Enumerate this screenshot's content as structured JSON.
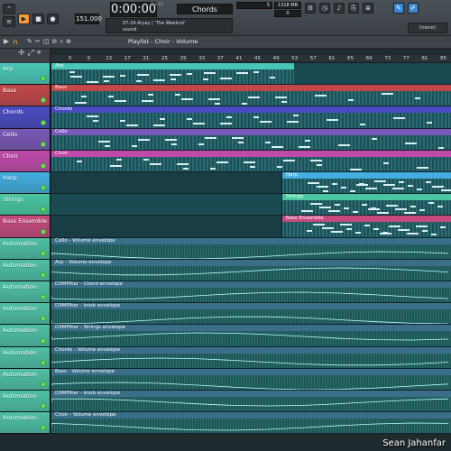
{
  "transport": {
    "time": "0:00:00",
    "time_unit": "M:S:CS",
    "tempo": "151.000",
    "pattern": "Chords",
    "voices": "5",
    "memory": "1318 MB",
    "mem_count": "0",
    "hint_line1": "07-24  Aryay | 'The Weeknd'",
    "hint_line2": "sound",
    "snap_label": "(none)"
  },
  "playlist": {
    "title": "Playlist - Choir - Volume",
    "ruler": [
      "5",
      "9",
      "13",
      "17",
      "21",
      "25",
      "29",
      "33",
      "37",
      "41",
      "45",
      "49",
      "53",
      "57",
      "61",
      "65",
      "69",
      "73",
      "77",
      "81",
      "85"
    ]
  },
  "tracks": [
    {
      "name": "Arp",
      "color": "#49c7b6",
      "clip": "Arp"
    },
    {
      "name": "Bass",
      "color": "#c2474a",
      "clip": "Bass"
    },
    {
      "name": "Chords",
      "color": "#4b4bc1",
      "clip": "Chords"
    },
    {
      "name": "Cello",
      "color": "#7a58b8",
      "clip": "Cello"
    },
    {
      "name": "Choir",
      "color": "#c04aa9",
      "clip": "Choir"
    },
    {
      "name": "Harp",
      "color": "#44aee0",
      "clip": "Harp"
    },
    {
      "name": "Strings",
      "color": "#49c7a0",
      "clip": "Strings"
    },
    {
      "name": "Bass Ensemble",
      "color": "#c54a7c",
      "clip": "Bass Ensemble"
    },
    {
      "name": "Automation",
      "color": "#4fc0a4",
      "clip": "Cello - Volume envelope"
    },
    {
      "name": "Automation",
      "color": "#4fc0a4",
      "clip": "Arp - Volume envelope"
    },
    {
      "name": "Automation",
      "color": "#4fc0a4",
      "clip": "D3MFilter - Chord envelope"
    },
    {
      "name": "Automation",
      "color": "#4fc0a4",
      "clip": "D3MFilter - knob envelope"
    },
    {
      "name": "Automation",
      "color": "#4fc0a4",
      "clip": "D3MFilter - Strings envelope"
    },
    {
      "name": "Automation",
      "color": "#4fc0a4",
      "clip": "Chords - Volume envelope"
    },
    {
      "name": "Automation",
      "color": "#4fc0a4",
      "clip": "Bass - Volume envelope"
    },
    {
      "name": "Automation",
      "color": "#4fc0a4",
      "clip": "D3MFilter - knob envelope"
    },
    {
      "name": "Automation",
      "color": "#4fc0a4",
      "clip": "Choir - Volume envelope"
    }
  ],
  "watermark": "Sean Jahanfar"
}
